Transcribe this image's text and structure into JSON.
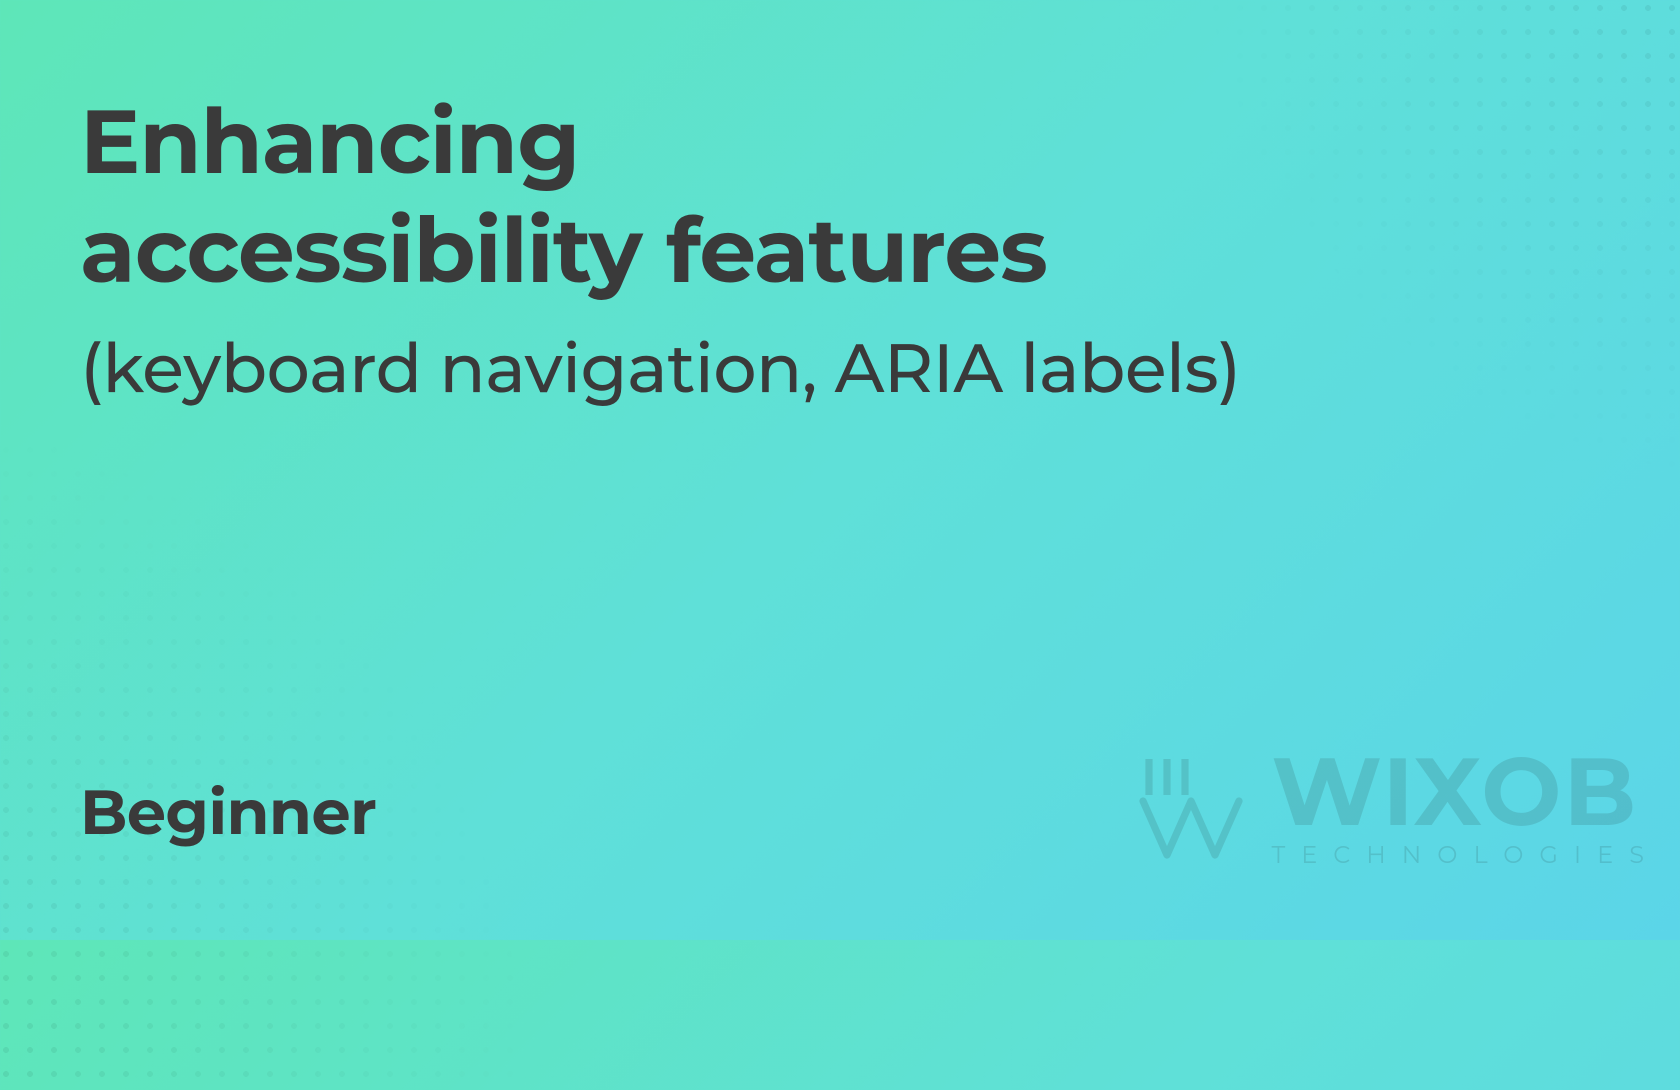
{
  "title": {
    "line1": "Enhancing",
    "line2": "accessibility features"
  },
  "subtitle": "(keyboard navigation, ARIA labels)",
  "level": "Beginner",
  "watermark": {
    "brand": "WIXOB",
    "tagline": "TECHNOLOGIES"
  }
}
